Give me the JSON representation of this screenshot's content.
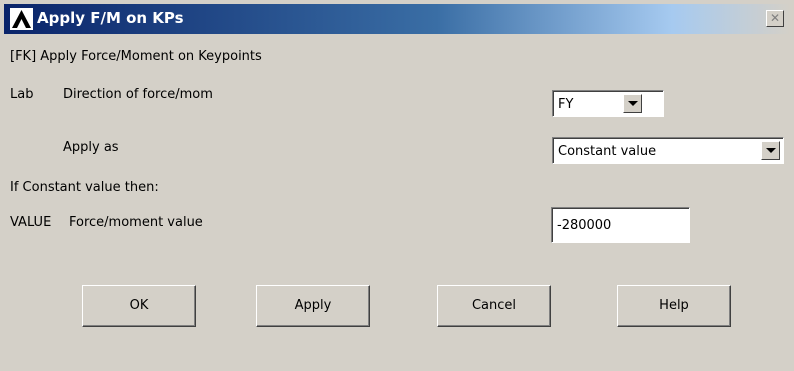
{
  "window": {
    "title": "Apply F/M on KPs",
    "close_icon": "close-icon",
    "logo_icon": "ansys-logo-icon"
  },
  "header": "[FK]  Apply Force/Moment on Keypoints",
  "fields": {
    "lab": {
      "code": "Lab",
      "label": "Direction of force/mom",
      "selected": "FY"
    },
    "apply_as": {
      "label": "Apply as",
      "selected": "Constant value"
    },
    "constant_note": "If Constant value then:",
    "value": {
      "code": "VALUE",
      "label": "Force/moment value",
      "value": "-280000"
    }
  },
  "buttons": {
    "ok": "OK",
    "apply": "Apply",
    "cancel": "Cancel",
    "help": "Help"
  },
  "colors": {
    "title_bar_start": "#0a246a",
    "title_bar_end": "#a6caf0",
    "dialog_bg": "#d4d0c8"
  }
}
